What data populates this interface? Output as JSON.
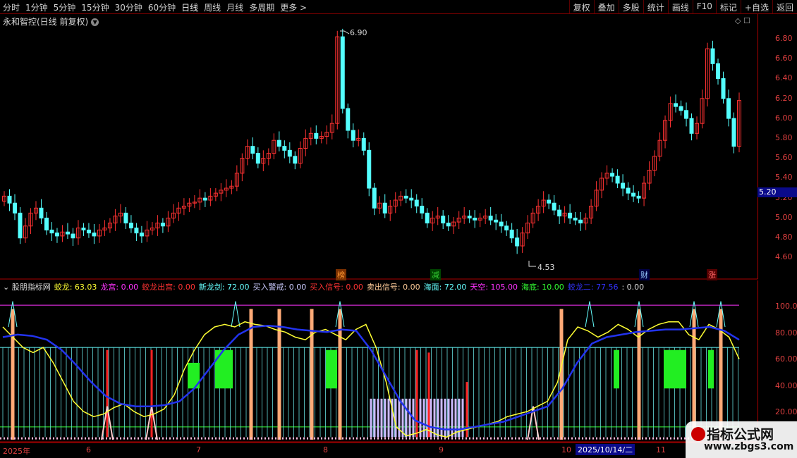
{
  "topbar": {
    "periods": [
      "分时",
      "1分钟",
      "5分钟",
      "15分钟",
      "30分钟",
      "60分钟",
      "日线",
      "周线",
      "月线",
      "多周期",
      "更多 >"
    ],
    "right_buttons": [
      "复权",
      "叠加",
      "多股",
      "统计",
      "画线",
      "F10",
      "标记",
      "+自选",
      "返回"
    ]
  },
  "chart_title": "永和智控(日线 前复权)",
  "main_icons": "◇ ☐",
  "price_axis": [
    "6.80",
    "6.60",
    "6.40",
    "6.20",
    "6.00",
    "5.80",
    "5.60",
    "5.40",
    "5.20",
    "5.00",
    "4.80",
    "4.60"
  ],
  "current_price": "5.20",
  "high_label": "6.90",
  "low_label": "4.53",
  "signals": [
    {
      "text": "榜",
      "color": "#ff9933"
    },
    {
      "text": "减",
      "color": "#33cc33"
    },
    {
      "text": "财",
      "color": "#99ccff"
    },
    {
      "text": "涨",
      "color": "#ff6666"
    }
  ],
  "sub_indicator": {
    "name": "股朋指标网",
    "items": [
      {
        "label": "蛟龙:",
        "value": "63.03",
        "color": "#ffff33"
      },
      {
        "label": "龙宫:",
        "value": "0.00",
        "color": "#ff33ff"
      },
      {
        "label": "蛟龙出宫:",
        "value": "0.00",
        "color": "#ff3333"
      },
      {
        "label": "新龙剑:",
        "value": "72.00",
        "color": "#66ffff"
      },
      {
        "label": "买入警戒:",
        "value": "0.00",
        "color": "#ccccff"
      },
      {
        "label": "买入信号:",
        "value": "0.00",
        "color": "#ff3333"
      },
      {
        "label": "卖出信号:",
        "value": "0.00",
        "color": "#ffcc99"
      },
      {
        "label": "海面:",
        "value": "72.00",
        "color": "#66ffff"
      },
      {
        "label": "天空:",
        "value": "105.00",
        "color": "#ff33ff"
      },
      {
        "label": "海底:",
        "value": "10.00",
        "color": "#33ff33"
      },
      {
        "label": "蛟龙二:",
        "value": "77.56",
        "color": "#3333ff"
      },
      {
        "label": ":",
        "value": "0.00",
        "color": "#dddddd"
      }
    ]
  },
  "sub_axis": [
    "100.00",
    "80.00",
    "60.00",
    "40.00",
    "20.00"
  ],
  "date_axis": [
    "2025年",
    "6",
    "7",
    "8",
    "9",
    "10",
    "11"
  ],
  "date_cursor": "2025/10/14/二",
  "watermark": {
    "line1": "指标公式网",
    "line2": "www.zbgs3.com"
  },
  "colors": {
    "up": "#ff3232",
    "down": "#54ffff",
    "axis": "#aa0000"
  }
}
